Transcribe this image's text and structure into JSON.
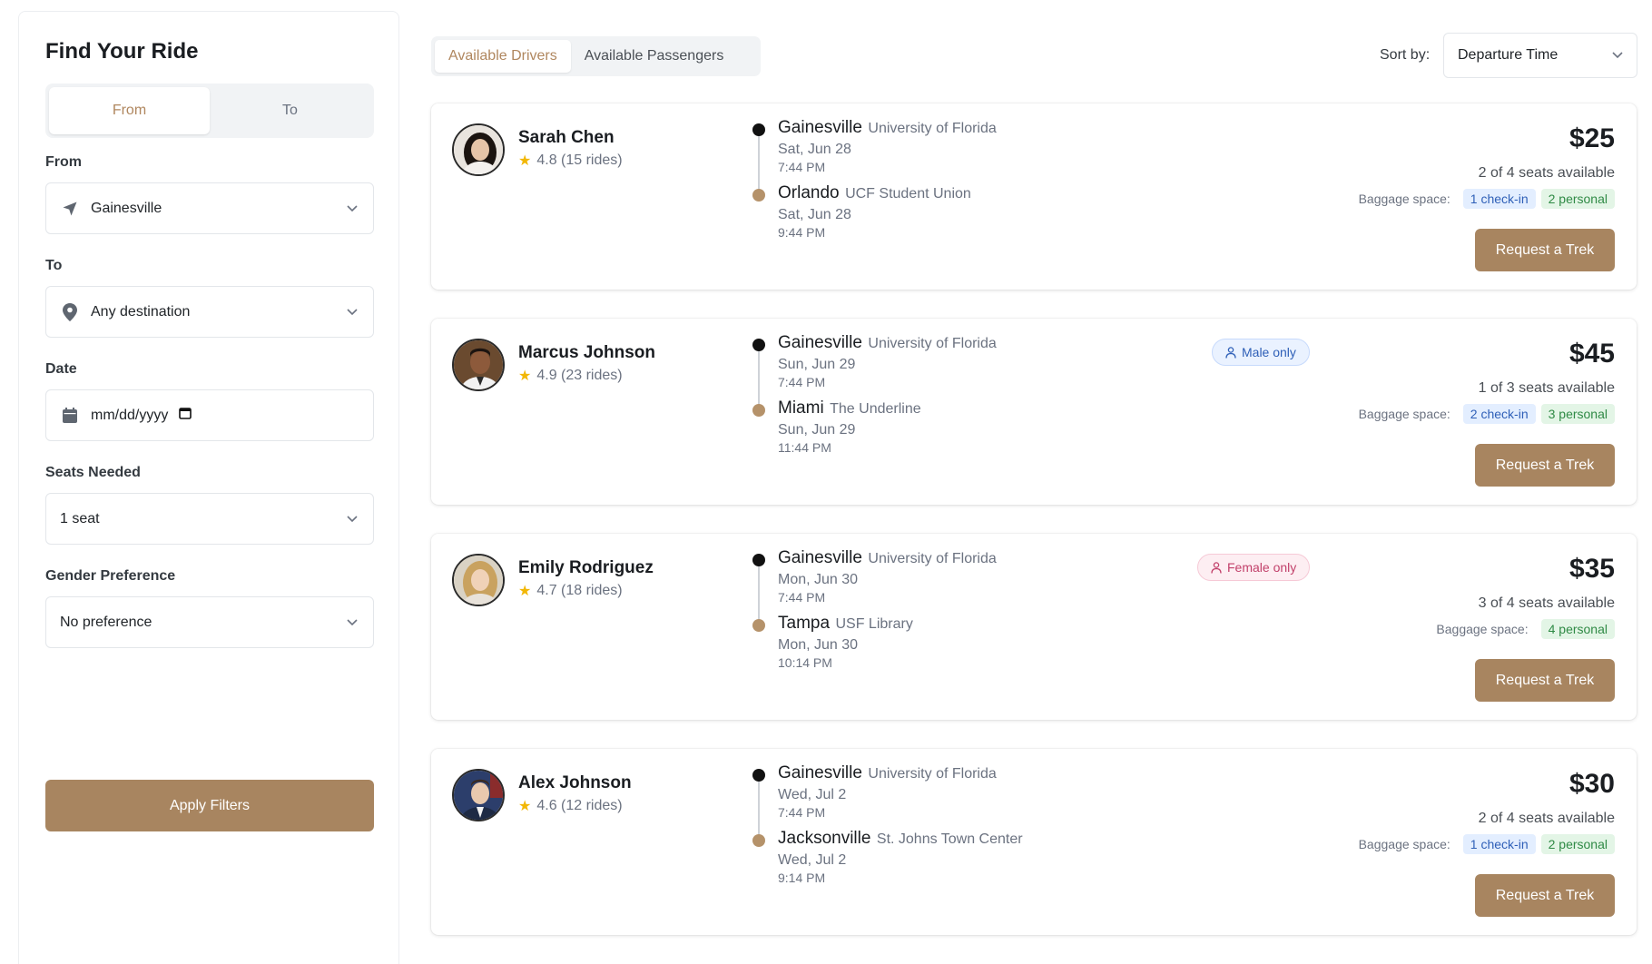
{
  "sidebar": {
    "title": "Find Your Ride",
    "toggle": {
      "from": "From",
      "to": "To"
    },
    "from": {
      "label": "From",
      "value": "Gainesville"
    },
    "to": {
      "label": "To",
      "value": "Any destination"
    },
    "date": {
      "label": "Date",
      "placeholder": "mm/dd/yyyy"
    },
    "seats": {
      "label": "Seats Needed",
      "value": "1 seat"
    },
    "gender": {
      "label": "Gender Preference",
      "value": "No preference"
    },
    "apply": "Apply Filters"
  },
  "tabs": {
    "drivers": "Available Drivers",
    "passengers": "Available Passengers",
    "active": "drivers"
  },
  "sort": {
    "label": "Sort by:",
    "value": "Departure Time"
  },
  "rides": [
    {
      "name": "Sarah Chen",
      "rating": "4.8 (15 rides)",
      "origin": {
        "city": "Gainesville",
        "place": "University of Florida",
        "date": "Sat, Jun 28",
        "time": "7:44 PM"
      },
      "dest": {
        "city": "Orlando",
        "place": "UCF Student Union",
        "date": "Sat, Jun 28",
        "time": "9:44 PM"
      },
      "gender": "",
      "price": "$25",
      "seats": "2 of 4 seats available",
      "baggage_label": "Baggage space:",
      "checkin": "1 check-in",
      "personal": "2 personal",
      "button": "Request a Trek"
    },
    {
      "name": "Marcus Johnson",
      "rating": "4.9 (23 rides)",
      "origin": {
        "city": "Gainesville",
        "place": "University of Florida",
        "date": "Sun, Jun 29",
        "time": "7:44 PM"
      },
      "dest": {
        "city": "Miami",
        "place": "The Underline",
        "date": "Sun, Jun 29",
        "time": "11:44 PM"
      },
      "gender": "Male only",
      "price": "$45",
      "seats": "1 of 3 seats available",
      "baggage_label": "Baggage space:",
      "checkin": "2 check-in",
      "personal": "3 personal",
      "button": "Request a Trek"
    },
    {
      "name": "Emily Rodriguez",
      "rating": "4.7 (18 rides)",
      "origin": {
        "city": "Gainesville",
        "place": "University of Florida",
        "date": "Mon, Jun 30",
        "time": "7:44 PM"
      },
      "dest": {
        "city": "Tampa",
        "place": "USF Library",
        "date": "Mon, Jun 30",
        "time": "10:14 PM"
      },
      "gender": "Female only",
      "price": "$35",
      "seats": "3 of 4 seats available",
      "baggage_label": "Baggage space:",
      "checkin": "",
      "personal": "4 personal",
      "button": "Request a Trek"
    },
    {
      "name": "Alex Johnson",
      "rating": "4.6 (12 rides)",
      "origin": {
        "city": "Gainesville",
        "place": "University of Florida",
        "date": "Wed, Jul 2",
        "time": "7:44 PM"
      },
      "dest": {
        "city": "Jacksonville",
        "place": "St. Johns Town Center",
        "date": "Wed, Jul 2",
        "time": "9:14 PM"
      },
      "gender": "",
      "price": "$30",
      "seats": "2 of 4 seats available",
      "baggage_label": "Baggage space:",
      "checkin": "1 check-in",
      "personal": "2 personal",
      "button": "Request a Trek"
    }
  ],
  "colors": {
    "accent": "#a88560",
    "accent_text": "#b0875f",
    "dest_dot": "#b5926a",
    "star": "#f2b705"
  },
  "icons": {
    "from": "navigation-arrow-icon",
    "to": "map-pin-icon",
    "date": "calendar-icon",
    "select": "chevron-down-icon",
    "star": "star-icon",
    "male": "person-icon",
    "female": "person-icon"
  }
}
